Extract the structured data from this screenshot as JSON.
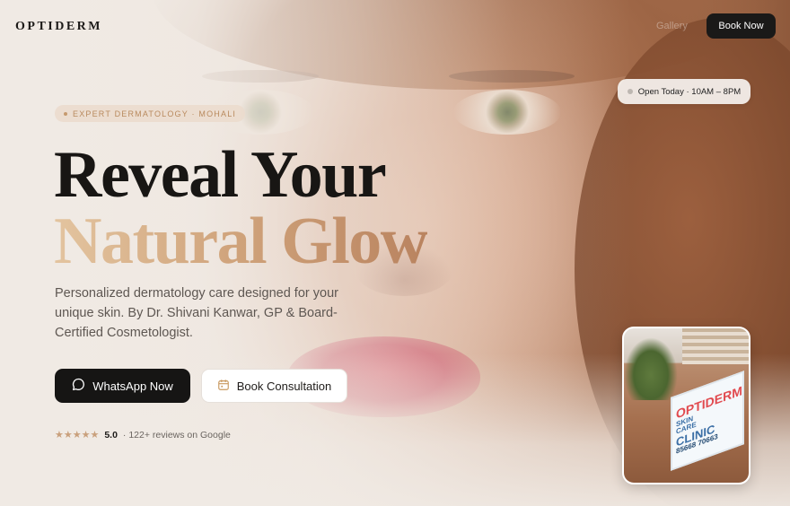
{
  "header": {
    "brand": "OPTIDERM",
    "nav_gallery": "Gallery",
    "book_now": "Book Now"
  },
  "status": {
    "open_text": "Open Today · 10AM – 8PM"
  },
  "hero": {
    "tag": "EXPERT DERMATOLOGY · MOHALI",
    "headline_line1": "Reveal Your",
    "headline_line2": "Natural Glow",
    "subtext": "Personalized dermatology care designed for your unique skin. By Dr. Shivani Kanwar, GP & Board-Certified Cosmetologist.",
    "whatsapp_label": "WhatsApp Now",
    "consult_label": "Book Consultation"
  },
  "rating": {
    "stars": "★★★★★",
    "score": "5.0",
    "reviews": "· 122+ reviews on Google"
  },
  "clinic_sign": {
    "brand": "OPTIDERM",
    "sub1": "SKIN",
    "sub2": "CARE",
    "clinic": "CLINIC",
    "phone": "85668 70663"
  },
  "colors": {
    "accent_gold": "#cfa27a",
    "dark": "#161514",
    "sign_red": "#e14a4f",
    "sign_blue": "#3b6fa6"
  },
  "icons": {
    "whatsapp": "whatsapp-icon",
    "calendar": "calendar-icon",
    "star": "star-icon"
  }
}
